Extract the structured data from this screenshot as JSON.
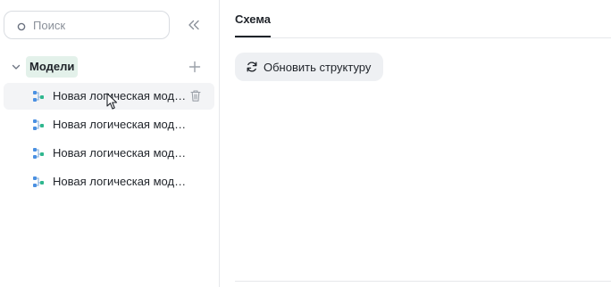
{
  "search": {
    "placeholder": "Поиск"
  },
  "sidebar": {
    "root_label": "Модели",
    "items": [
      {
        "label": "Новая логическая модель"
      },
      {
        "label": "Новая логическая модель"
      },
      {
        "label": "Новая логическая модель"
      },
      {
        "label": "Новая логическая модель"
      }
    ]
  },
  "main": {
    "tab_label": "Схема",
    "refresh_label": "Обновить структуру"
  },
  "colors": {
    "root_highlight": "#e3f1ea",
    "model_icon_blue": "#4a90e2",
    "model_icon_green": "#2fb78e"
  }
}
